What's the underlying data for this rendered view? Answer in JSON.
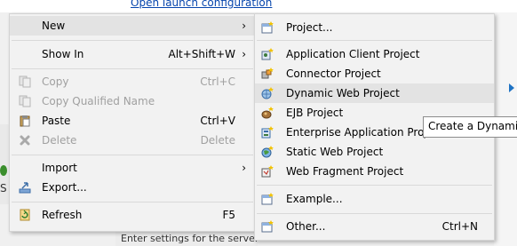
{
  "background": {
    "launch_link": "Open launch configuration",
    "bottom_hint": "Enter settings for the server",
    "left_letter": "S"
  },
  "context_menu": {
    "items": [
      {
        "label": "New",
        "submenu": true,
        "highlighted": true
      },
      {
        "label": "Show In",
        "shortcut": "Alt+Shift+W",
        "submenu": true
      },
      {
        "label": "Copy",
        "shortcut": "Ctrl+C",
        "disabled": true,
        "icon": "copy-icon"
      },
      {
        "label": "Copy Qualified Name",
        "disabled": true,
        "icon": "copy-qualified-name-icon"
      },
      {
        "label": "Paste",
        "shortcut": "Ctrl+V",
        "icon": "paste-icon"
      },
      {
        "label": "Delete",
        "shortcut": "Delete",
        "disabled": true,
        "icon": "delete-icon"
      },
      {
        "label": "Import",
        "submenu": true
      },
      {
        "label": "Export...",
        "icon": "export-icon"
      },
      {
        "label": "Refresh",
        "shortcut": "F5",
        "icon": "refresh-icon"
      }
    ],
    "arrow_glyph": "›"
  },
  "new_submenu": {
    "items": [
      {
        "label": "Project...",
        "icon": "new-project-icon"
      },
      {
        "label": "Application Client Project",
        "icon": "application-client-project-icon"
      },
      {
        "label": "Connector Project",
        "icon": "connector-project-icon"
      },
      {
        "label": "Dynamic Web Project",
        "icon": "dynamic-web-project-icon",
        "highlighted": true
      },
      {
        "label": "EJB Project",
        "icon": "ejb-project-icon"
      },
      {
        "label": "Enterprise Application Project",
        "icon": "enterprise-application-project-icon"
      },
      {
        "label": "Static Web Project",
        "icon": "static-web-project-icon"
      },
      {
        "label": "Web Fragment Project",
        "icon": "web-fragment-project-icon"
      },
      {
        "label": "Example...",
        "icon": "example-icon"
      },
      {
        "label": "Other...",
        "shortcut": "Ctrl+N",
        "icon": "other-wizard-icon"
      }
    ]
  },
  "tooltip": {
    "text": "Create a Dynamic W"
  },
  "colors": {
    "menu_bg": "#f2f2f2",
    "highlight": "#e3e3e3",
    "disabled_text": "#a0a0a0",
    "link": "#0645ad",
    "accent_blue": "#1f73c4"
  }
}
